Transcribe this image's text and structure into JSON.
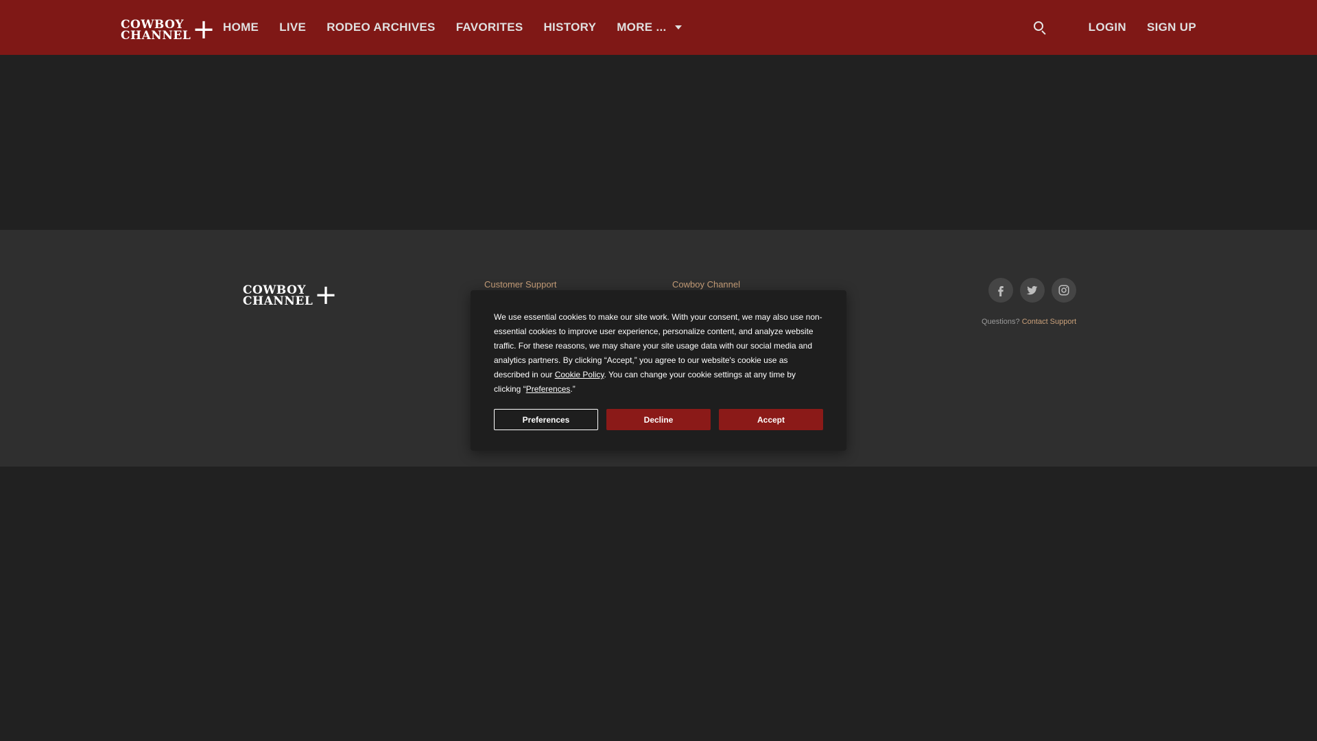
{
  "brand": {
    "line1": "COWBOY",
    "line2": "CHANNEL",
    "plus": "+",
    "header_color": "#7f1816",
    "accent_color": "#c9a07a"
  },
  "nav": {
    "items": [
      "HOME",
      "LIVE",
      "RODEO ARCHIVES",
      "FAVORITES",
      "HISTORY"
    ],
    "more_label": "MORE ..."
  },
  "header": {
    "search_icon": "search-icon",
    "login_label": "LOGIN",
    "signup_label": "SIGN UP"
  },
  "footer": {
    "col1_title": "Customer Support",
    "col2_title": "Cowboy Channel",
    "social_icons": [
      "facebook-icon",
      "twitter-icon",
      "instagram-icon"
    ],
    "questions_prefix": "Questions?",
    "contact_link": "Contact Support"
  },
  "cookie": {
    "text_1": "We use essential cookies to make our site work. With your consent, we may also use non-essential cookies to improve user experience, personalize content, and analyze website traffic. For these reasons, we may share your site usage data with our social media and analytics partners. By clicking “Accept,” you agree to our website's cookie use as described in our ",
    "cookie_policy_link": "Cookie Policy",
    "text_2": ". You can change your cookie settings at any time by clicking “",
    "preferences_link": "Preferences",
    "text_3": ".”",
    "preferences_button": "Preferences",
    "decline_button": "Decline",
    "accept_button": "Accept"
  }
}
